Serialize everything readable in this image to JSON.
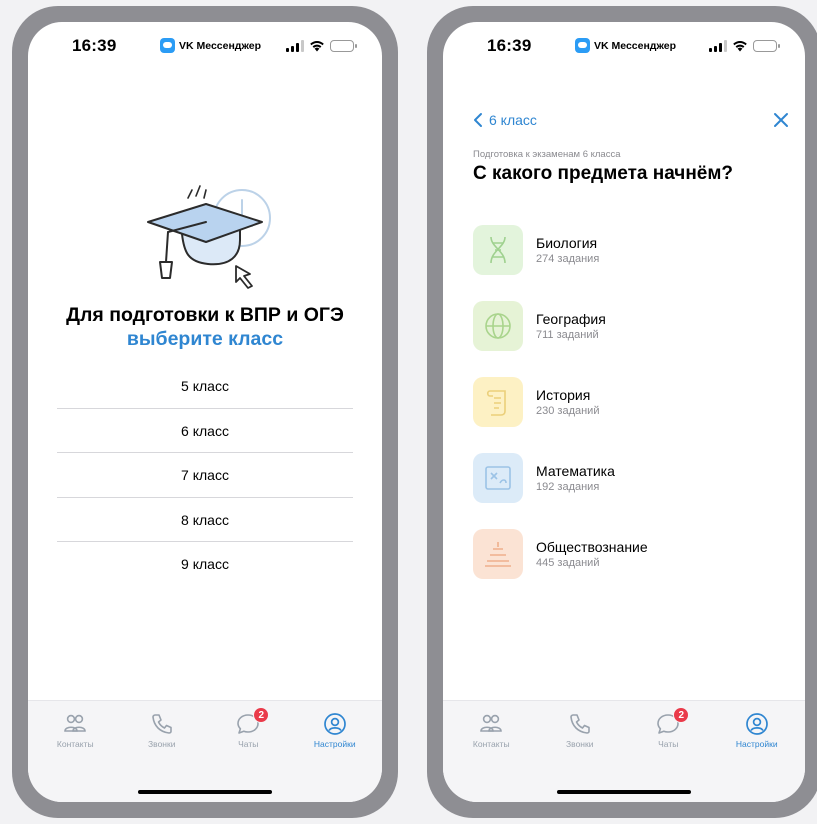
{
  "status_bar": {
    "time": "16:39",
    "app_name": "VK Мессенджер"
  },
  "class_screen": {
    "title_line1": "Для подготовки к ВПР и ОГЭ",
    "title_line2": "выберите класс",
    "classes": [
      "5 класс",
      "6 класс",
      "7 класс",
      "8 класс",
      "9 класс"
    ]
  },
  "subject_screen": {
    "back_label": "6 класс",
    "subtitle": "Подготовка к экзаменам 6 класса",
    "heading": "С какого предмета начнём?",
    "subjects": [
      {
        "name": "Биология",
        "count": "274 задания",
        "color": "#e3f4dc",
        "icon": "dna-icon"
      },
      {
        "name": "География",
        "count": "711 заданий",
        "color": "#e6f3d6",
        "icon": "globe-icon"
      },
      {
        "name": "История",
        "count": "230 заданий",
        "color": "#fdf1c4",
        "icon": "scroll-icon"
      },
      {
        "name": "Математика",
        "count": "192 задания",
        "color": "#dcebf8",
        "icon": "math-board-icon"
      },
      {
        "name": "Обществознание",
        "count": "445 заданий",
        "color": "#fbe3d4",
        "icon": "pyramid-icon"
      }
    ]
  },
  "tab_bar": {
    "tabs": [
      {
        "label": "Контакты",
        "icon": "contacts-icon"
      },
      {
        "label": "Звонки",
        "icon": "phone-icon"
      },
      {
        "label": "Чаты",
        "icon": "chat-icon",
        "badge": "2"
      },
      {
        "label": "Настройки",
        "icon": "settings-profile-icon",
        "active": true
      }
    ]
  },
  "colors": {
    "accent": "#2f86d1",
    "badge": "#ea3a4a",
    "frame": "#8e8e93"
  }
}
